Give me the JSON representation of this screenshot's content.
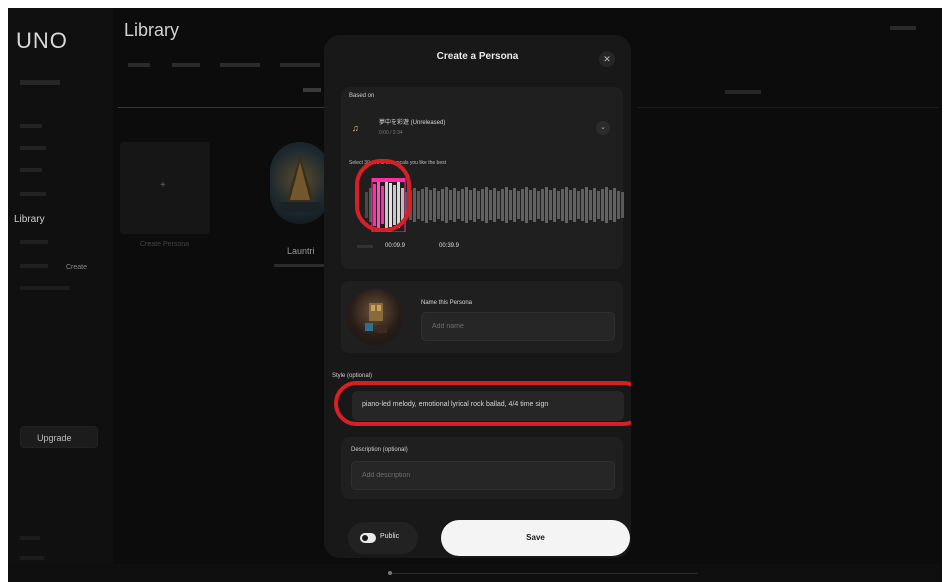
{
  "app": {
    "logo": "UNO"
  },
  "sidebar": {
    "library": "Library",
    "create": "Create",
    "upgrade": "Upgrade"
  },
  "library": {
    "title": "Library",
    "create_persona": "Create Persona",
    "item_name": "Launtri"
  },
  "modal": {
    "title": "Create a Persona",
    "close_icon": "close-icon",
    "based_on": {
      "label": "Based on",
      "song_title": "夢中を彩遊 (Unreleased)",
      "song_duration": "0:00 / 2:34",
      "select_prompt": "Select 30 sec of the vocals you like the best",
      "start_time": "00:09.9",
      "end_time": "00:39.9"
    },
    "name": {
      "label": "Name this Persona",
      "placeholder": "Add name"
    },
    "style": {
      "label": "Style (optional)",
      "value": "piano-led melody, emotional lyrical rock ballad, 4/4 time sign"
    },
    "description": {
      "label": "Description (optional)",
      "placeholder": "Add description"
    },
    "public_label": "Public",
    "save_label": "Save"
  },
  "annotation": {
    "highlight_color": "#d62026"
  }
}
